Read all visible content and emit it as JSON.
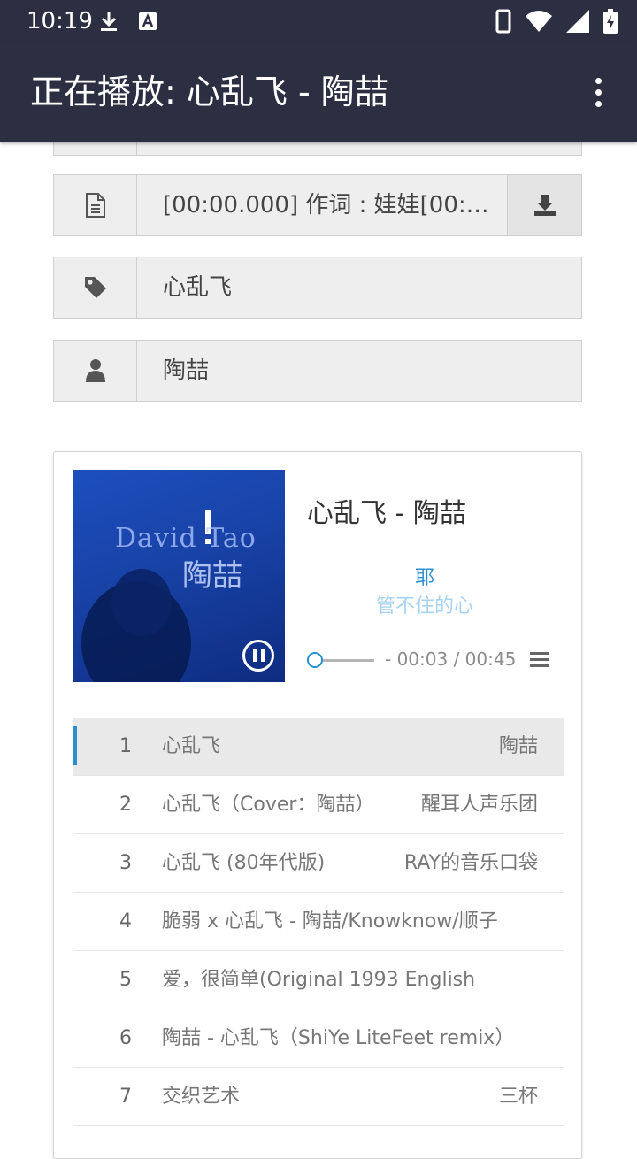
{
  "status_bar": {
    "time": "10:19"
  },
  "app_bar": {
    "title": "正在播放: 心乱飞 - 陶喆"
  },
  "fields": {
    "lyrics_text": "[00:00.000] 作词 : 娃娃[00:0...",
    "title_text": "心乱飞",
    "artist_text": "陶喆"
  },
  "player": {
    "song_title": "心乱飞 - 陶喆",
    "lyric_current": "耶",
    "lyric_next": "管不住的心",
    "time_readout": "- 00:03 / 00:45",
    "progress_fraction": 0.07,
    "cover_text_en": "David Tao",
    "cover_text_cn": "陶喆"
  },
  "playlist": [
    {
      "num": "1",
      "title": "心乱飞",
      "artist": "陶喆",
      "active": true
    },
    {
      "num": "2",
      "title": "心乱飞（Cover：陶喆）",
      "artist": "醒耳人声乐团"
    },
    {
      "num": "3",
      "title": "心乱飞 (80年代版)",
      "artist": "RAY的音乐口袋"
    },
    {
      "num": "4",
      "title": "脆弱 x 心乱飞 - 陶喆/Knowknow/顺子",
      "artist": ""
    },
    {
      "num": "5",
      "title": "爱，很简单(Original 1993 English",
      "artist": ""
    },
    {
      "num": "6",
      "title": "陶喆 - 心乱飞（ShiYe LiteFeet remix）",
      "artist": ""
    },
    {
      "num": "7",
      "title": "交织艺术",
      "artist": "三杯"
    }
  ],
  "colors": {
    "app_bar": "#2c2f42",
    "accent": "#2b8fd1"
  }
}
